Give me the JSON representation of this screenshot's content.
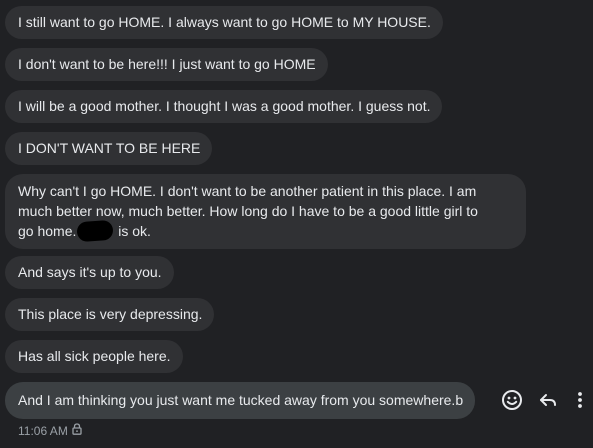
{
  "messages": [
    "I still want to go HOME. I always want to go HOME to MY HOUSE.",
    "I don't want to be here!!!  I just want to go HOME",
    "I will be a good mother. I thought I was a good mother. I guess not.",
    "I DON'T WANT TO BE HERE",
    {
      "line1": "Why can't I go HOME. I don't want to be another patient in this place. I am",
      "line2": "much better now,  much better. How long do I have to be a good little girl to",
      "line3_start": "go home.",
      "line3_end": "is ok."
    },
    "And says it's up to you.",
    "This place is very depressing.",
    "Has all sick people here.",
    "And I am thinking you just want me tucked away from you somewhere.b"
  ],
  "timestamp": "11:06 AM",
  "icons": {
    "react": "smiley-icon",
    "reply": "reply-arrow-icon",
    "more": "more-vert-icon",
    "lock": "lock-icon"
  },
  "colors": {
    "background": "#202124",
    "bubble": "#303134",
    "bubble_hover": "#3c4043",
    "text": "#e8eaed",
    "meta_text": "#9aa0a6"
  }
}
